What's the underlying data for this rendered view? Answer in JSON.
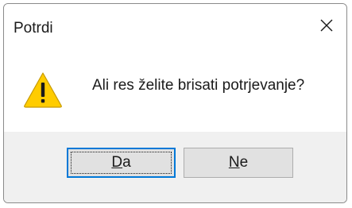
{
  "dialog": {
    "title": "Potrdi",
    "close_icon": "close-icon",
    "message": "Ali res želite brisati potrjevanje?",
    "icon": "warning-icon",
    "colors": {
      "warning_fill": "#ffcc00",
      "focus_border": "#0078d7",
      "button_face": "#e1e1e1",
      "footer_bg": "#f0f0f0"
    },
    "buttons": {
      "yes": {
        "mnemonic": "D",
        "rest": "a"
      },
      "no": {
        "mnemonic": "N",
        "rest": "e"
      }
    }
  }
}
